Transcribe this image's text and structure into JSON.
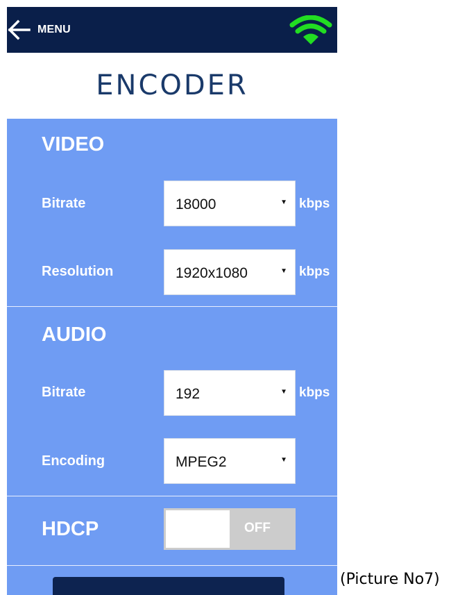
{
  "header": {
    "menu_label": "MENU"
  },
  "page": {
    "title": "ENCODER"
  },
  "video": {
    "section_title": "VIDEO",
    "bitrate": {
      "label": "Bitrate",
      "value": "18000",
      "unit": "kbps"
    },
    "resolution": {
      "label": "Resolution",
      "value": "1920x1080",
      "unit": "kbps"
    }
  },
  "audio": {
    "section_title": "AUDIO",
    "bitrate": {
      "label": "Bitrate",
      "value": "192",
      "unit": "kbps"
    },
    "encoding": {
      "label": "Encoding",
      "value": "MPEG2"
    }
  },
  "hdcp": {
    "label": "HDCP",
    "state": "OFF"
  },
  "caption": "(Picture No7)",
  "colors": {
    "header_bg": "#0a1f4a",
    "panel_bg": "#6f9cf3",
    "wifi": "#22dd22",
    "toggle_off": "#cccccc"
  },
  "icons": {
    "back": "arrow-left-icon",
    "wifi": "wifi-icon",
    "dropdown": "caret-down-icon"
  }
}
